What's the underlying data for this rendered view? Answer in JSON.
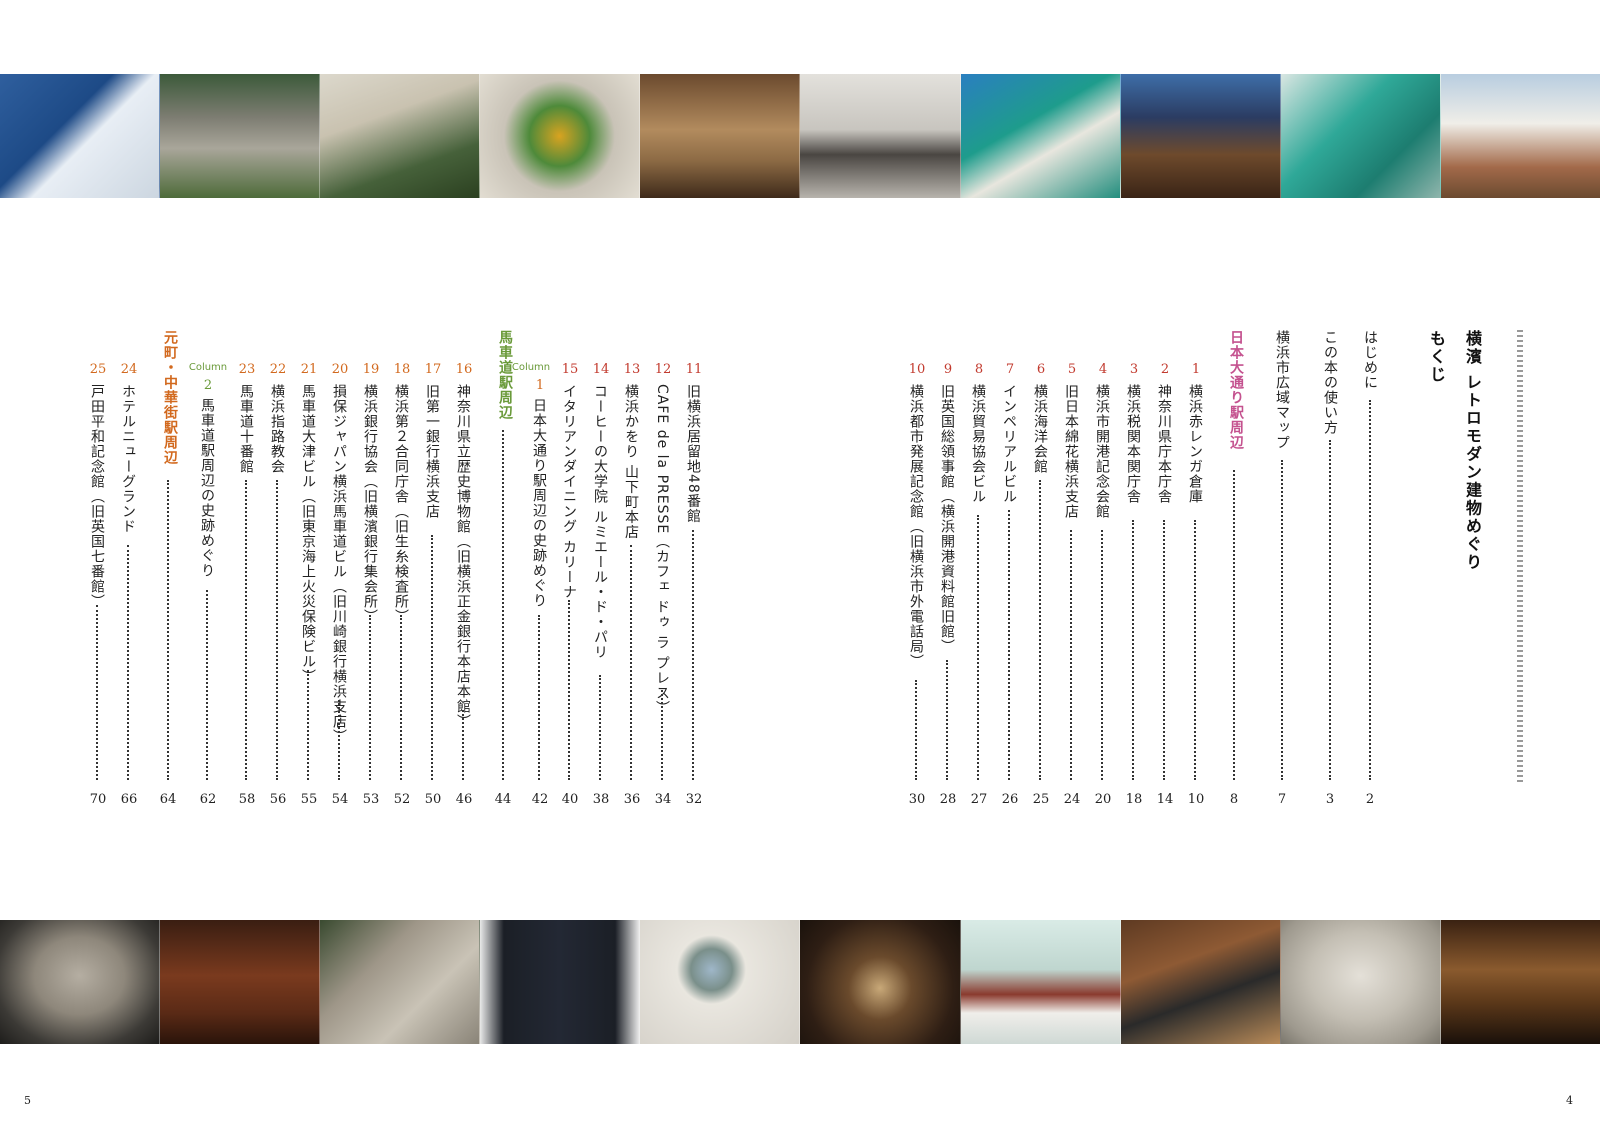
{
  "book": {
    "title": "横濱 レトロモダン建物めぐり",
    "subtitle": "もくじ"
  },
  "front": [
    {
      "label": "はじめに",
      "page": "2"
    },
    {
      "label": "この本の使い方",
      "page": "3"
    },
    {
      "label": "横浜市広域マップ",
      "page": "7"
    }
  ],
  "sections": [
    {
      "label": "日本大通り駅周辺",
      "page": "8",
      "color": "#c4528f"
    },
    {
      "label": "馬車道駅周辺",
      "page": "44",
      "color": "#6a9a3a"
    },
    {
      "label": "元町・中華街駅周辺",
      "page": "64",
      "color": "#d2691e"
    }
  ],
  "entries": [
    {
      "num": "1",
      "label": "横浜赤レンガ倉庫",
      "page": "10"
    },
    {
      "num": "2",
      "label": "神奈川県庁本庁舎",
      "page": "14"
    },
    {
      "num": "3",
      "label": "横浜税関本関庁舎",
      "page": "18"
    },
    {
      "num": "4",
      "label": "横浜市開港記念会館",
      "page": "20"
    },
    {
      "num": "5",
      "label": "旧日本綿花横浜支店",
      "page": "24"
    },
    {
      "num": "6",
      "label": "横浜海洋会館",
      "page": "25"
    },
    {
      "num": "7",
      "label": "インペリアルビル",
      "page": "26"
    },
    {
      "num": "8",
      "label": "横浜貿易協会ビル",
      "page": "27"
    },
    {
      "num": "9",
      "label": "旧英国総領事館（横浜開港資料館旧館）",
      "page": "28"
    },
    {
      "num": "10",
      "label": "横浜都市発展記念館（旧横浜市外電話局）",
      "page": "30"
    },
    {
      "num": "11",
      "label": "旧横浜居留地48番館",
      "page": "32"
    },
    {
      "num": "12",
      "label": "CAFE de la PRESSE（カフェ ドゥ ラ プレス）",
      "page": "34"
    },
    {
      "num": "13",
      "label": "横浜かをり 山下町本店",
      "page": "36"
    },
    {
      "num": "14",
      "label": "コーヒーの大学院 ルミエール・ド・パリ",
      "page": "38"
    },
    {
      "num": "15",
      "label": "イタリアンダイニング カリーナ",
      "page": "40"
    },
    {
      "num": "16",
      "label": "神奈川県立歴史博物館（旧横浜正金銀行本店本館）",
      "page": "46"
    },
    {
      "num": "17",
      "label": "旧第一銀行横浜支店",
      "page": "50"
    },
    {
      "num": "18",
      "label": "横浜第２合同庁舎（旧生糸検査所）",
      "page": "52"
    },
    {
      "num": "19",
      "label": "横浜銀行協会（旧横濱銀行集会所）",
      "page": "53"
    },
    {
      "num": "20",
      "label": "損保ジャパン横浜馬車道ビル（旧川崎銀行横浜支店）",
      "page": "54"
    },
    {
      "num": "21",
      "label": "馬車道大津ビル（旧東京海上火災保険ビル）",
      "page": "55"
    },
    {
      "num": "22",
      "label": "横浜指路教会",
      "page": "56"
    },
    {
      "num": "23",
      "label": "馬車道十番館",
      "page": "58"
    },
    {
      "num": "24",
      "label": "ホテルニューグランド",
      "page": "66"
    },
    {
      "num": "25",
      "label": "戸田平和記念館（旧英国七番館）",
      "page": "70"
    }
  ],
  "columns": [
    {
      "tag": "Column",
      "num": "1",
      "label": "日本大通り駅周辺の史跡めぐり",
      "page": "42"
    },
    {
      "tag": "Column",
      "num": "2",
      "label": "馬車道駅周辺の史跡めぐり",
      "page": "62"
    }
  ],
  "folios": {
    "left": "5",
    "right": "4"
  },
  "photos_top": [
    {
      "subject": "blue tiled bathroom"
    },
    {
      "subject": "stone gate post 234 with flowers"
    },
    {
      "subject": "colonnade porch with lamp"
    },
    {
      "subject": "green horse carriage sign"
    },
    {
      "subject": "cafe interior with chandelier"
    },
    {
      "subject": "stone bank entrance"
    },
    {
      "subject": "teal window frames"
    },
    {
      "subject": "brick building at dusk"
    },
    {
      "subject": "teal porch with lantern"
    },
    {
      "subject": "white villa with gate"
    }
  ],
  "photos_bottom": [
    {
      "subject": "stone plaque"
    },
    {
      "subject": "wood bar counter with lamp"
    },
    {
      "subject": "stone relief on wall"
    },
    {
      "subject": "dark doors with ornaments"
    },
    {
      "subject": "round window"
    },
    {
      "subject": "carved wood chrysanthemum"
    },
    {
      "subject": "table with flowers by window"
    },
    {
      "subject": "antique typewriter"
    },
    {
      "subject": "stone carving"
    },
    {
      "subject": "coffee cups"
    }
  ]
}
